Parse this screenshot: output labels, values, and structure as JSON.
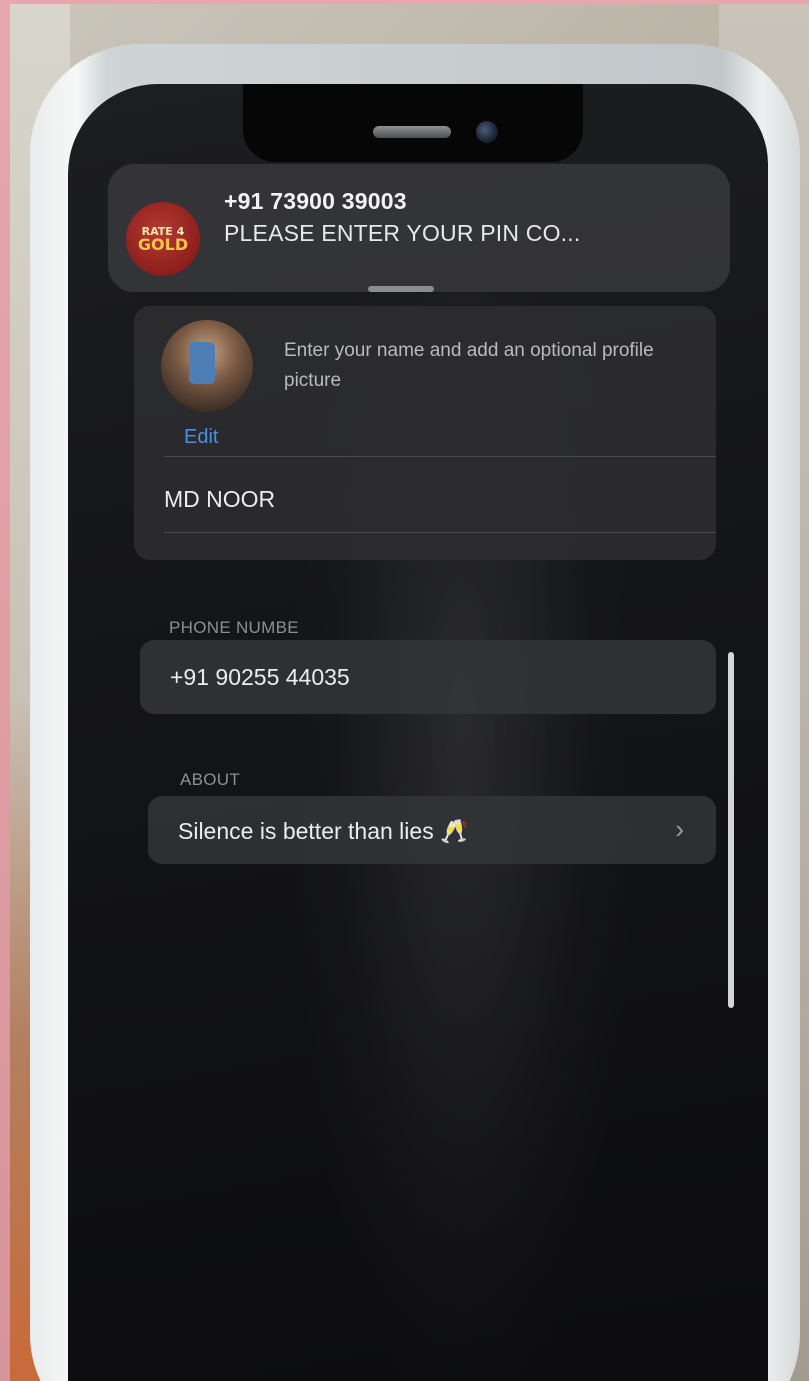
{
  "notification": {
    "avatar_line1": "RATE 4",
    "avatar_line2": "GOLD",
    "title": "+91 73900 39003",
    "body": "PLEASE ENTER YOUR PIN CO..."
  },
  "profile": {
    "edit_label": "Edit",
    "hint": "Enter your name and add an optional profile picture",
    "name": "MD NOOR"
  },
  "phone_section": {
    "label": "PHONE NUMBE",
    "value": "+91 90255 44035"
  },
  "about_section": {
    "label": "ABOUT",
    "value": "Silence is better than lies 🥂"
  },
  "colors": {
    "accent": "#4a90e2",
    "badge": "#e03b35"
  }
}
